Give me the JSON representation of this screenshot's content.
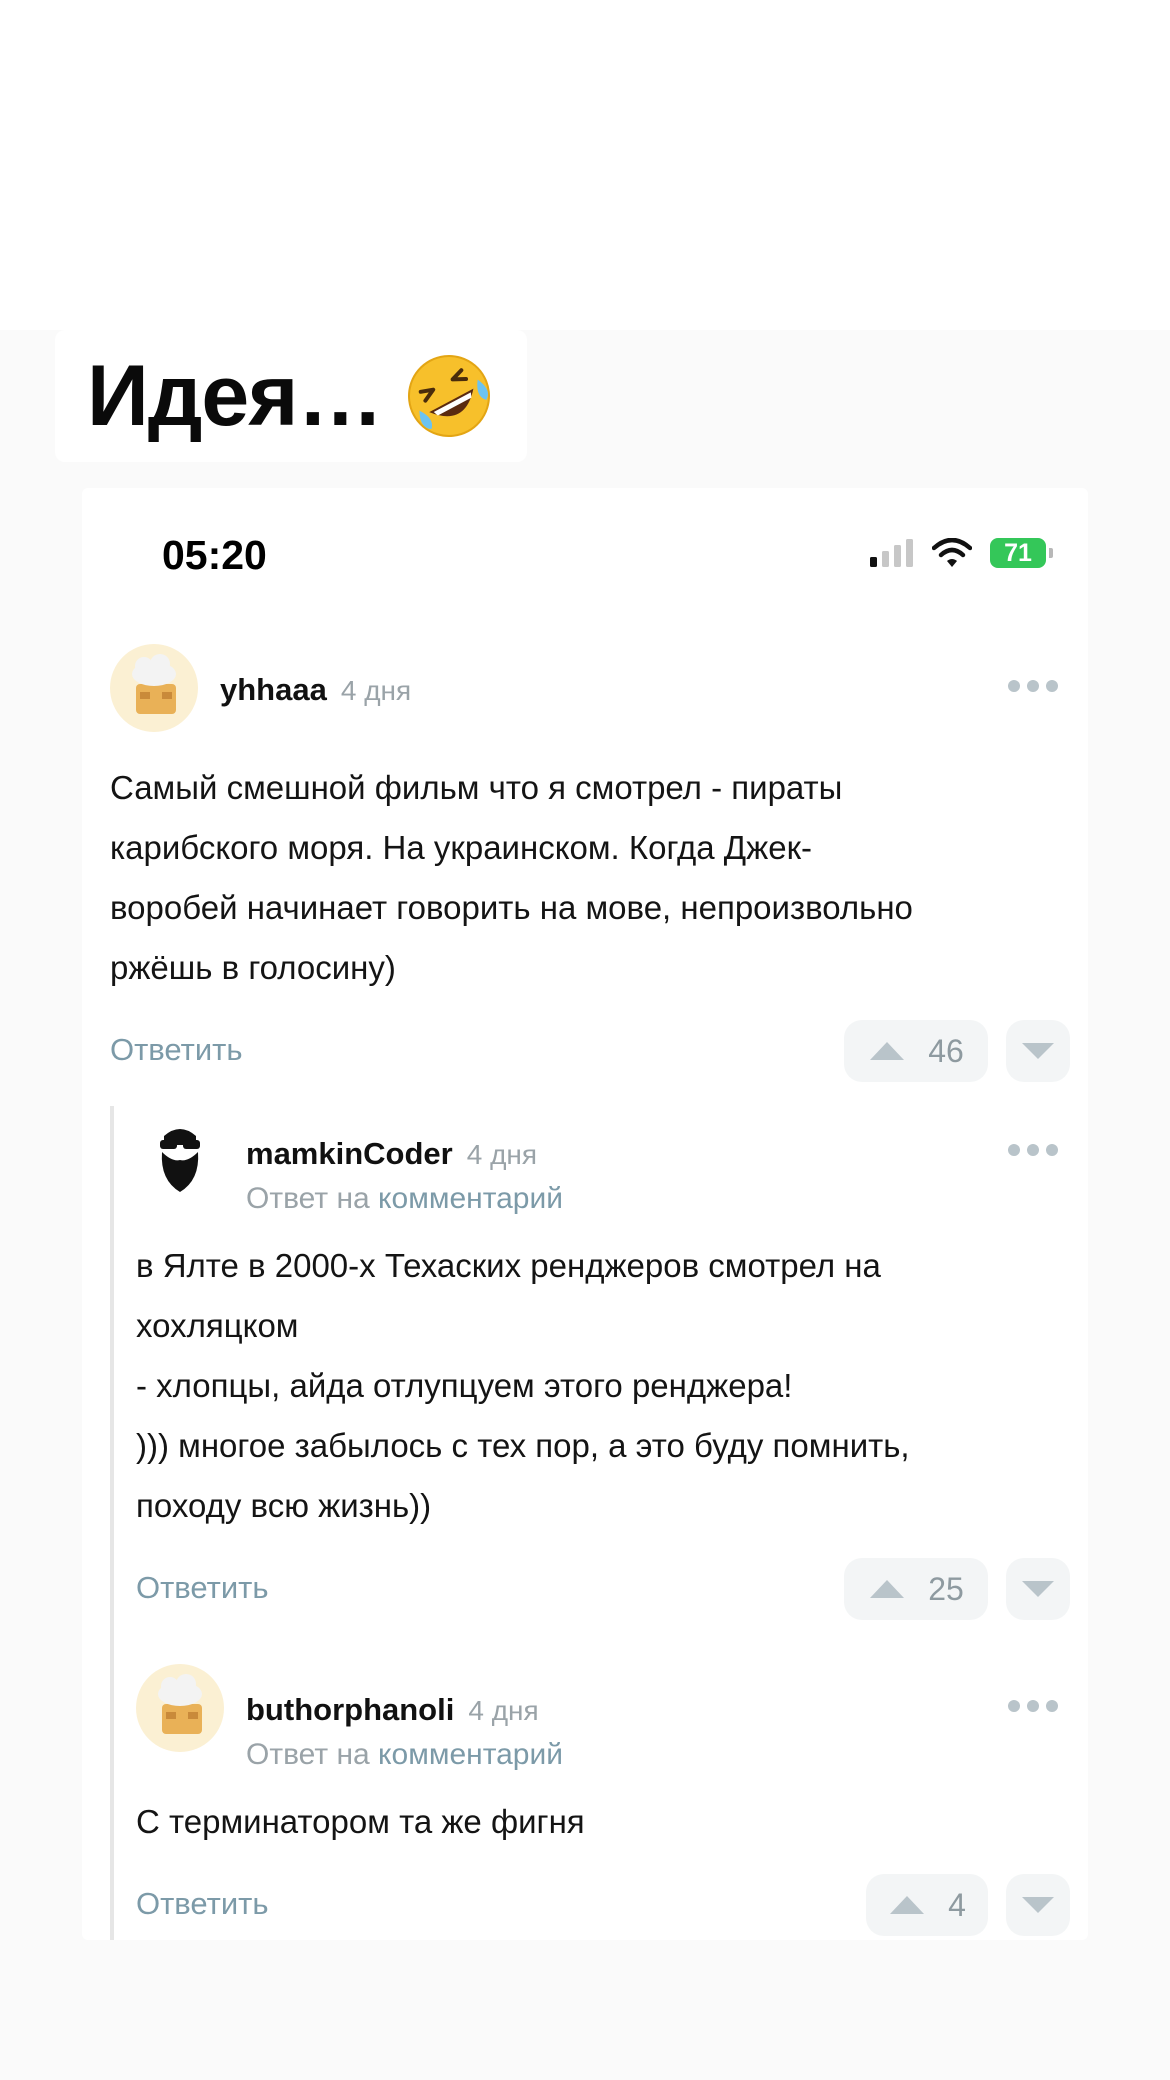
{
  "caption": {
    "text": "Идея…",
    "emoji": "rolling-on-floor-laughing-emoji"
  },
  "status_bar": {
    "time": "05:20",
    "battery": "71"
  },
  "comments": [
    {
      "username": "yhhaaa",
      "time": "4 дня",
      "text": "Самый смешной фильм что я смотрел - пираты\nкарибского моря. На украинском. Когда Джек-\nворобей начинает говорить на мове, непроизвольно\nржёшь в голосину)",
      "reply_label": "Ответить",
      "votes": "46"
    },
    {
      "username": "mamkinCoder",
      "time": "4 дня",
      "reply_to_prefix": "Ответ на",
      "reply_to_link": "комментарий",
      "text": "в Ялте в 2000-х Техаских ренджеров смотрел на\nхохляцком\n- хлопцы, айда отлупцуем этого ренджера!\n))) многое забылось с тех пор, а это буду помнить,\nпоходу всю жизнь))",
      "reply_label": "Ответить",
      "votes": "25"
    },
    {
      "username": "buthorphanoli",
      "time": "4 дня",
      "reply_to_prefix": "Ответ на",
      "reply_to_link": "комментарий",
      "text": "С терминатором та же фигня",
      "reply_label": "Ответить",
      "votes": "4"
    }
  ],
  "colors": {
    "accent": "#7c9aa8",
    "muted": "#9aa3a8",
    "battery": "#34c759"
  }
}
